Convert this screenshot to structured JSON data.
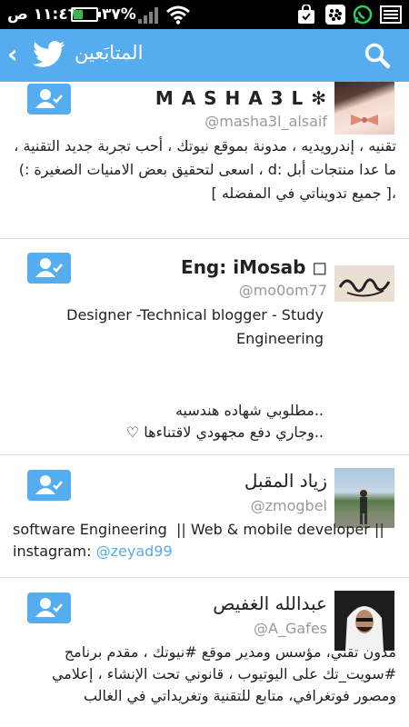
{
  "status_bar": {
    "time": "١١:٤٦ ص",
    "battery_percent": "٣٧%",
    "battery_level": 0.37,
    "colors": {
      "battery": "#3bb54a",
      "whatsapp": "#25d366",
      "bbm": "#ffffff"
    }
  },
  "app_bar": {
    "title": "المتابَعين",
    "back_icon": "chevron-left-icon",
    "logo_icon": "twitter-bird-icon",
    "search_icon": "search-icon",
    "color": "#55acee"
  },
  "users": [
    {
      "name": "M A S H A 3 L ✻",
      "handle": "@masha3l_alsaif",
      "bio": "تقنيه ، إندرويديه ، مدونة بموقع نيوتك ، أحب تجربة جديد التقنية ، ما عدا منتجات أبل :d ، اسعى لتحقيق بعض الامنيات الصغيرة :) ،[ جميع تدويناتي في المفضله ]"
    },
    {
      "name": "Eng: iMosab ◻",
      "handle": "@mo0om77",
      "bio_line1": "Designer -Technical blogger - Study Engineering",
      "bio_line2": "..مطلوبي شهاده هندسيه",
      "bio_line3": "..وجاري دفع مجهودي لاقتناءها ♡"
    },
    {
      "name": "زياد المقبل",
      "handle": "@zmogbel",
      "bio": "software Engineering  || Web & mobile developer || instagram: ",
      "bio_mention": "@zeyad99"
    },
    {
      "name": "عبدالله الغفيص",
      "handle": "@A_Gafes",
      "bio": "مدون تقني، مؤسس ومدير موقع #نيوتك ، مقدم برنامج #سويت_تك على اليوتيوب ، قانوني تحت الإنشاء ، إعلامي ومصور فوتغرافي، متابع للتقنية وتغريداتي في الغالب"
    }
  ],
  "follow_icon": "follow-user-check-icon"
}
